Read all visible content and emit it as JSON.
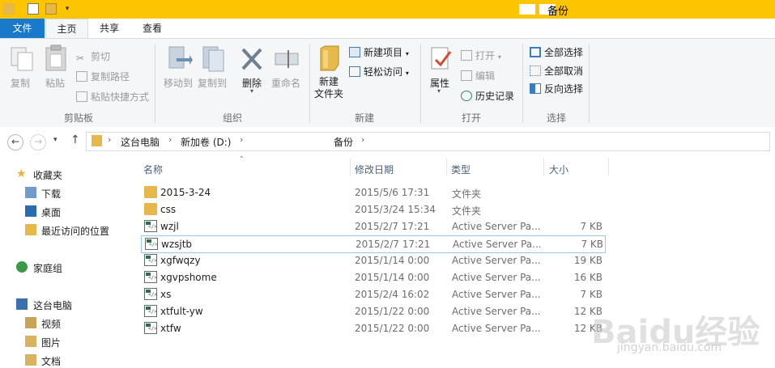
{
  "window": {
    "title": "备份"
  },
  "tabs": [
    "文件",
    "主页",
    "共享",
    "查看"
  ],
  "ribbon": {
    "clipboard": {
      "copy": "复制",
      "paste": "粘贴",
      "cut": "剪切",
      "copy_path": "复制路径",
      "paste_shortcut": "粘贴快捷方式",
      "group": "剪贴板"
    },
    "organize": {
      "move_to": "移动到",
      "copy_to": "复制到",
      "delete": "删除",
      "rename": "重命名",
      "group": "组织"
    },
    "new": {
      "new_folder": "新建\n文件夹",
      "new_item": "新建项目",
      "easy_access": "轻松访问",
      "group": "新建"
    },
    "open": {
      "properties": "属性",
      "open": "打开",
      "edit": "编辑",
      "history": "历史记录",
      "group": "打开"
    },
    "select": {
      "select_all": "全部选择",
      "select_none": "全部取消",
      "invert": "反向选择",
      "group": "选择"
    }
  },
  "address": {
    "crumbs": [
      "这台电脑",
      "新加卷 (D:)",
      "备份"
    ]
  },
  "nav": {
    "favorites": "收藏夹",
    "downloads": "下载",
    "desktop": "桌面",
    "recent": "最近访问的位置",
    "homegroup": "家庭组",
    "this_pc": "这台电脑",
    "videos": "视频",
    "pictures": "图片",
    "documents": "文档"
  },
  "columns": {
    "name": "名称",
    "date": "修改日期",
    "type": "类型",
    "size": "大小"
  },
  "files": [
    {
      "name": "2015-3-24",
      "date": "2015/5/6 17:31",
      "type": "文件夹",
      "size": "",
      "kind": "folder"
    },
    {
      "name": "css",
      "date": "2015/3/24 15:34",
      "type": "文件夹",
      "size": "",
      "kind": "folder"
    },
    {
      "name": "wzjl",
      "date": "2015/2/7 17:21",
      "type": "Active Server Pa...",
      "size": "7 KB",
      "kind": "asp"
    },
    {
      "name": "wzsjtb",
      "date": "2015/2/7 17:21",
      "type": "Active Server Pa...",
      "size": "7 KB",
      "kind": "asp"
    },
    {
      "name": "xgfwqzy",
      "date": "2015/1/14 0:00",
      "type": "Active Server Pa...",
      "size": "19 KB",
      "kind": "asp"
    },
    {
      "name": "xgvpshome",
      "date": "2015/1/14 0:00",
      "type": "Active Server Pa...",
      "size": "16 KB",
      "kind": "asp"
    },
    {
      "name": "xs",
      "date": "2015/2/4 16:02",
      "type": "Active Server Pa...",
      "size": "7 KB",
      "kind": "asp"
    },
    {
      "name": "xtfult-yw",
      "date": "2015/1/22 0:00",
      "type": "Active Server Pa...",
      "size": "12 KB",
      "kind": "asp"
    },
    {
      "name": "xtfw",
      "date": "2015/1/22 0:00",
      "type": "Active Server Pa...",
      "size": "12 KB",
      "kind": "asp"
    }
  ],
  "watermark": {
    "logo": "Bai du 经验",
    "url": "jingyan.baidu.com"
  },
  "colors": {
    "title_bar": "#fdc400",
    "file_tab": "#1979ca",
    "selection_border": "#99c9ef"
  }
}
